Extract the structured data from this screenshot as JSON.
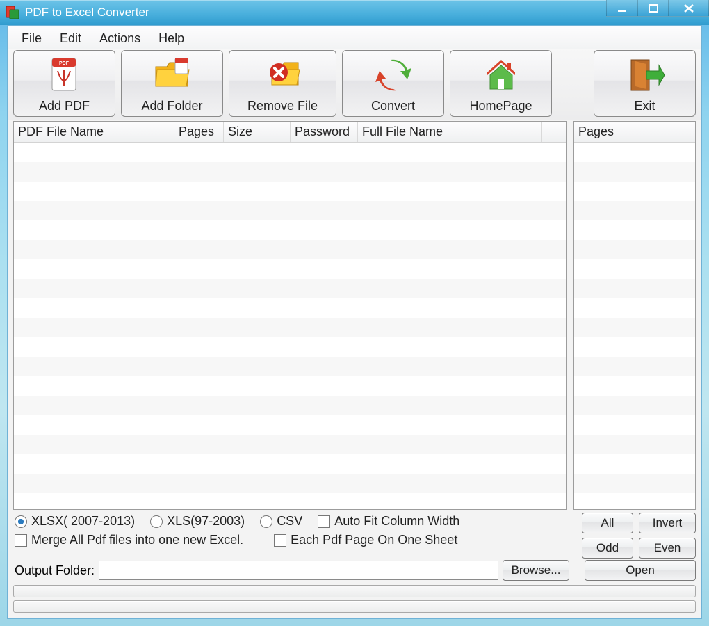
{
  "window": {
    "title": "PDF to Excel Converter"
  },
  "menubar": {
    "file": "File",
    "edit": "Edit",
    "actions": "Actions",
    "help": "Help"
  },
  "toolbar": {
    "add_pdf": "Add PDF",
    "add_folder": "Add Folder",
    "remove_file": "Remove File",
    "convert": "Convert",
    "homepage": "HomePage",
    "exit": "Exit"
  },
  "columns": {
    "pdf_file_name": "PDF File Name",
    "pages": "Pages",
    "size": "Size",
    "password": "Password",
    "full_file_name": "Full File Name"
  },
  "side_columns": {
    "pages": "Pages"
  },
  "options": {
    "xlsx": "XLSX( 2007-2013)",
    "xls": "XLS(97-2003)",
    "csv": "CSV",
    "autofit": "Auto Fit Column Width",
    "merge": "Merge All Pdf files into one new Excel.",
    "each_page": "Each Pdf Page On One Sheet",
    "selected_format": "xlsx"
  },
  "side_buttons": {
    "all": "All",
    "invert": "Invert",
    "odd": "Odd",
    "even": "Even",
    "open": "Open"
  },
  "output": {
    "label": "Output Folder:",
    "value": "",
    "browse": "Browse..."
  }
}
